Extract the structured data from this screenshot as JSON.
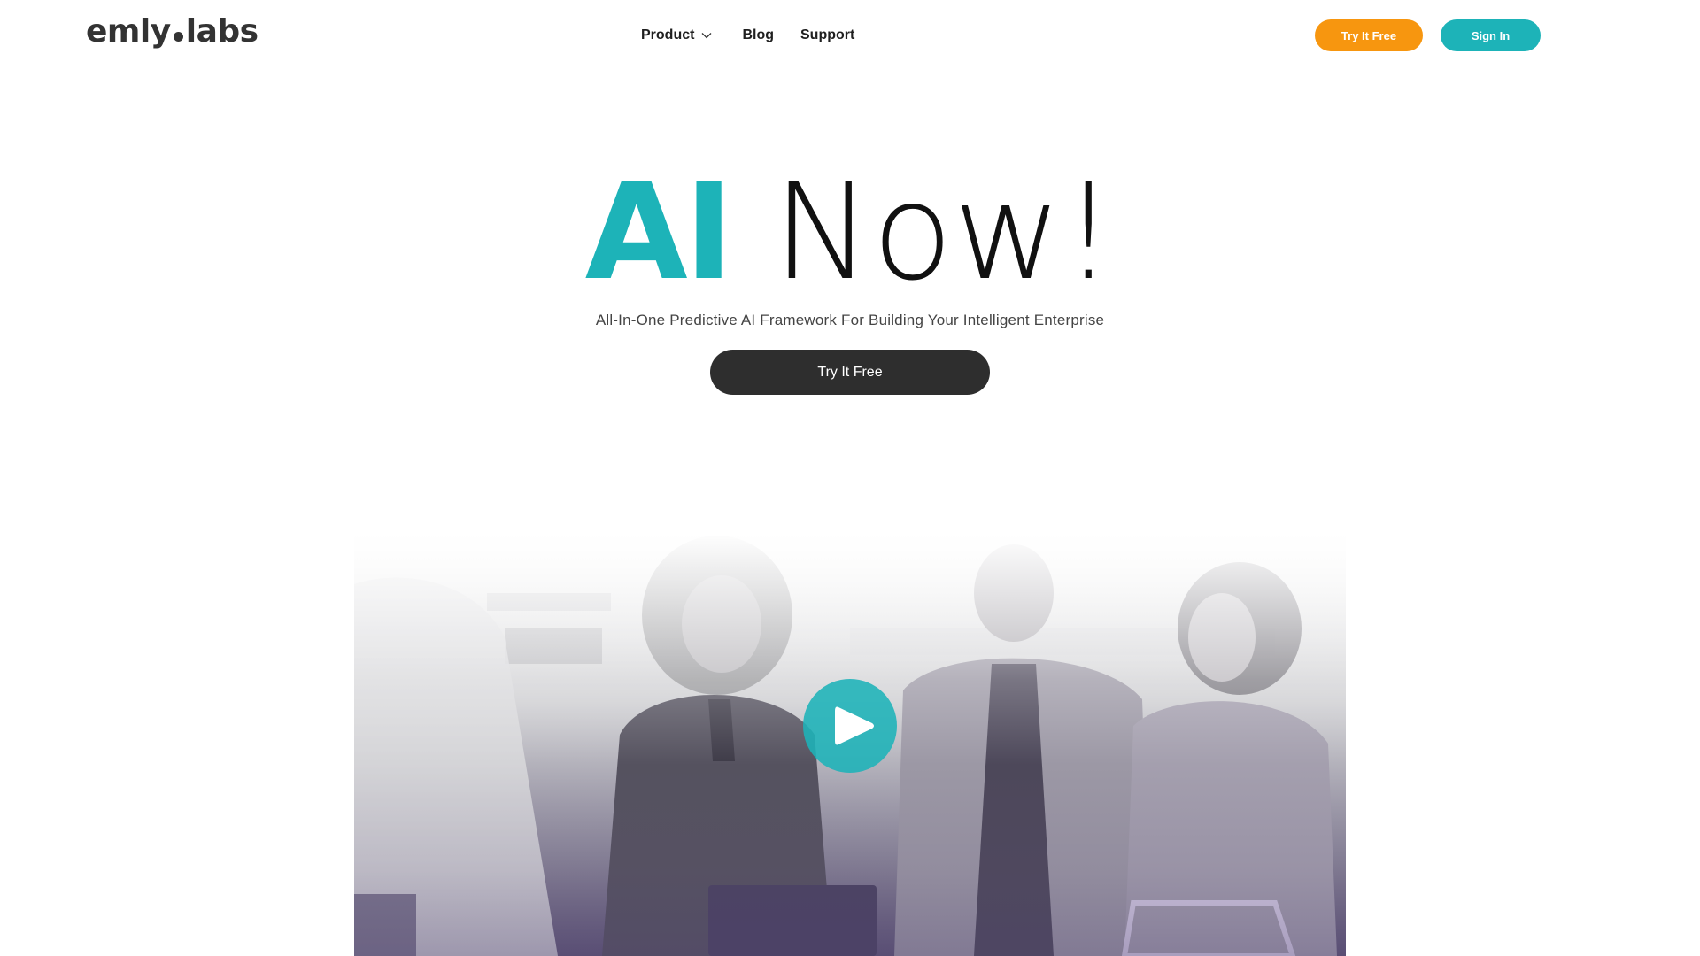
{
  "header": {
    "logo": {
      "left": "emly",
      "right": "labs"
    },
    "nav": [
      {
        "label": "Product",
        "has_dropdown": true
      },
      {
        "label": "Blog"
      },
      {
        "label": "Support"
      }
    ],
    "try_button": "Try It Free",
    "signin_button": "Sign In"
  },
  "hero": {
    "title_accent": "AI",
    "title_rest": "Now!",
    "subtitle": "All-In-One Predictive AI Framework For Building Your Intelligent Enterprise",
    "cta": "Try It Free"
  },
  "video": {
    "play_icon": "play-icon",
    "description": "Office team photo, grayscale with purple tint"
  },
  "colors": {
    "accent_teal": "#1db3b8",
    "accent_orange": "#f7960f",
    "dark_button": "#2e2e2e",
    "text_dark": "#1f1f1f"
  }
}
